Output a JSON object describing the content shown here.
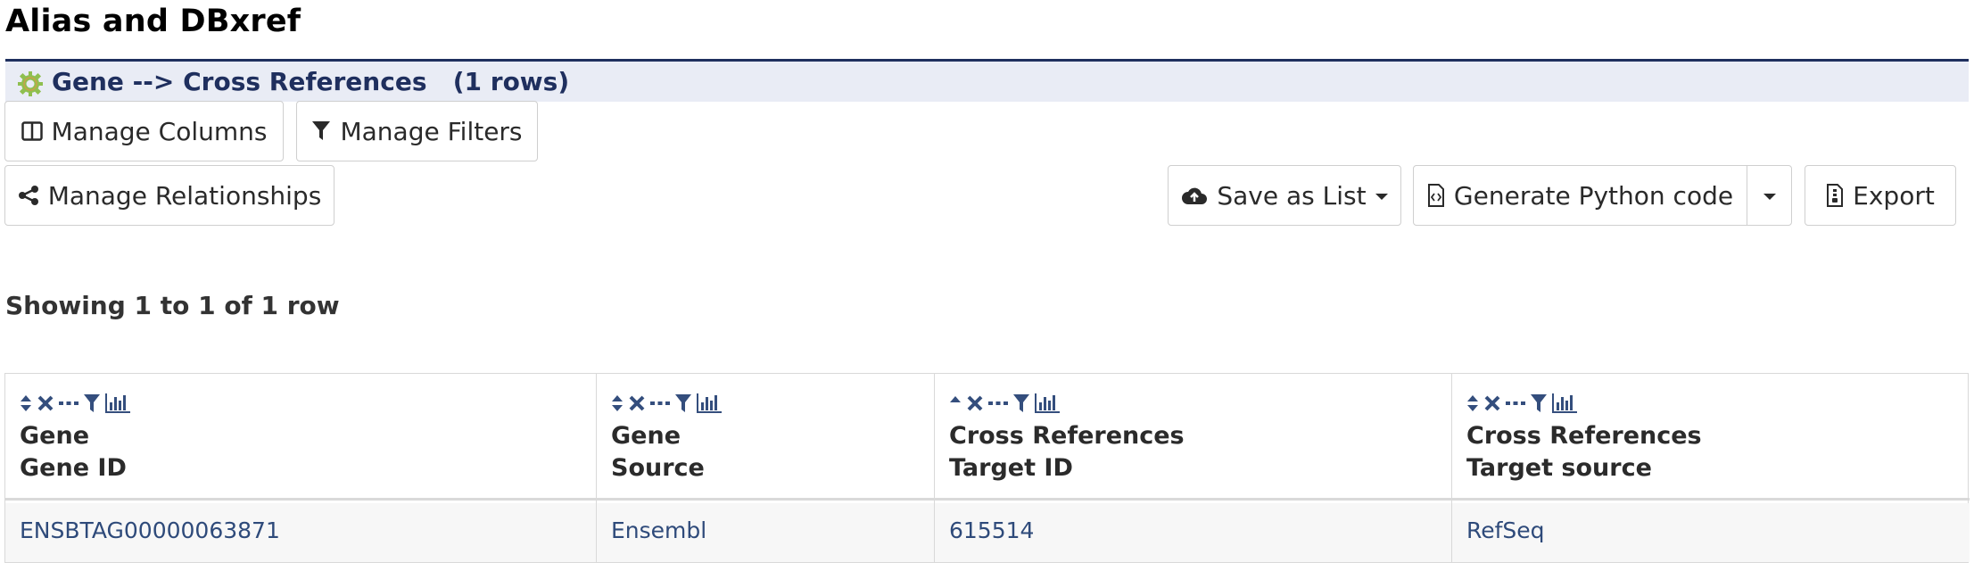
{
  "page": {
    "title": "Alias and DBxref"
  },
  "header": {
    "title": "Gene --> Cross References",
    "rows": "(1 rows)"
  },
  "toolbar": {
    "manage_columns": "Manage Columns",
    "manage_filters": "Manage Filters",
    "manage_relationships": "Manage Relationships",
    "save_as_list": "Save as List",
    "generate_python": "Generate Python code",
    "export": "Export"
  },
  "summary": {
    "showing": "Showing 1 to 1 of 1 row"
  },
  "table": {
    "columns": [
      {
        "line1": "Gene",
        "line2": "Gene ID",
        "sort": "unsorted"
      },
      {
        "line1": "Gene",
        "line2": "Source",
        "sort": "unsorted"
      },
      {
        "line1": "Cross References",
        "line2": "Target ID",
        "sort": "ascending"
      },
      {
        "line1": "Cross References",
        "line2": "Target source",
        "sort": "unsorted"
      }
    ],
    "rows": [
      [
        "ENSBTAG00000063871",
        "Ensembl",
        "615514",
        "RefSeq"
      ]
    ]
  },
  "colors": {
    "accent": "#1f2f5e",
    "header_bg": "#e9ecf5",
    "link": "#2e4a7a"
  }
}
